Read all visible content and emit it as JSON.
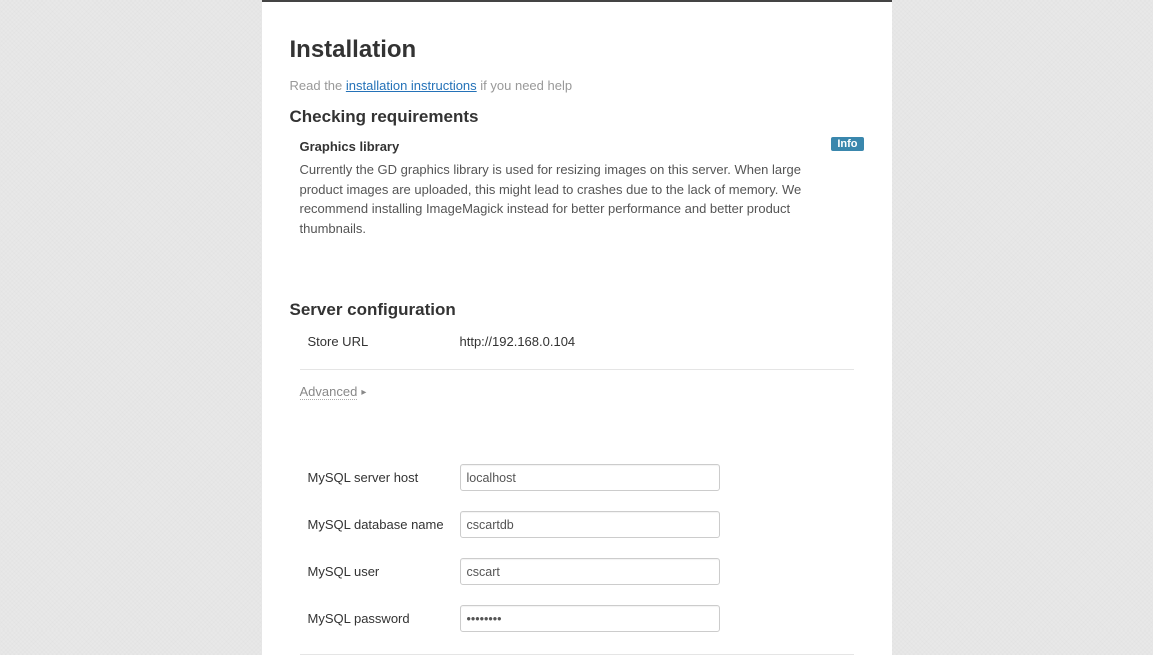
{
  "page": {
    "title": "Installation",
    "help_prefix": "Read the ",
    "help_link": "installation instructions",
    "help_suffix": " if you need help"
  },
  "requirements": {
    "heading": "Checking requirements",
    "item": {
      "title": "Graphics library",
      "badge": "Info",
      "text": "Currently the GD graphics library is used for resizing images on this server. When large product images are uploaded, this might lead to crashes due to the lack of memory. We recommend installing ImageMagick instead for better performance and better product thumbnails."
    }
  },
  "server": {
    "heading": "Server configuration",
    "store_url_label": "Store URL",
    "store_url_value": "http://192.168.0.104",
    "advanced_label": "Advanced"
  },
  "mysql": {
    "host_label": "MySQL server host",
    "host_value": "localhost",
    "db_label": "MySQL database name",
    "db_value": "cscartdb",
    "user_label": "MySQL user",
    "user_value": "cscart",
    "pass_label": "MySQL password",
    "pass_value": "••••••••"
  }
}
